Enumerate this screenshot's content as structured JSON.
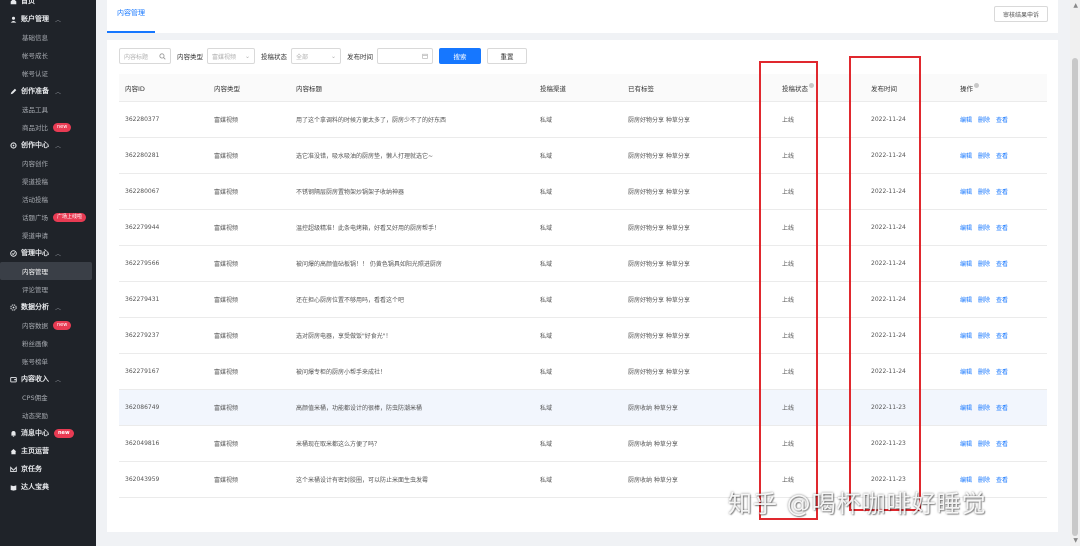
{
  "sidebar": {
    "items": [
      {
        "kind": "group",
        "label": "首页",
        "icon": "home-icon",
        "chev": false
      },
      {
        "kind": "group",
        "label": "账户管理",
        "icon": "user-icon",
        "chev": true
      },
      {
        "kind": "sub",
        "label": "基础信息"
      },
      {
        "kind": "sub",
        "label": "帐号成长"
      },
      {
        "kind": "sub",
        "label": "帐号认证"
      },
      {
        "kind": "group",
        "label": "创作准备",
        "icon": "pen-icon",
        "chev": true
      },
      {
        "kind": "sub",
        "label": "选品工具"
      },
      {
        "kind": "sub",
        "label": "商品对比",
        "badge": "new"
      },
      {
        "kind": "group",
        "label": "创作中心",
        "icon": "gear-icon",
        "chev": true
      },
      {
        "kind": "sub",
        "label": "内容创作"
      },
      {
        "kind": "sub",
        "label": "渠道投稿"
      },
      {
        "kind": "sub",
        "label": "活动投稿"
      },
      {
        "kind": "sub",
        "label": "话题广场",
        "badge": "广场上线啦"
      },
      {
        "kind": "sub",
        "label": "渠道申请"
      },
      {
        "kind": "group",
        "label": "管理中心",
        "icon": "check-circle-icon",
        "chev": true
      },
      {
        "kind": "sub",
        "label": "内容管理",
        "active": true
      },
      {
        "kind": "sub",
        "label": "评论管理"
      },
      {
        "kind": "group",
        "label": "数据分析",
        "icon": "settings-icon",
        "chev": true
      },
      {
        "kind": "sub",
        "label": "内容数据",
        "badge": "new"
      },
      {
        "kind": "sub",
        "label": "粉丝画像"
      },
      {
        "kind": "sub",
        "label": "账号榜单"
      },
      {
        "kind": "group",
        "label": "内容收入",
        "icon": "wallet-icon",
        "chev": true
      },
      {
        "kind": "sub",
        "label": "CPS佣金"
      },
      {
        "kind": "sub",
        "label": "动态奖励"
      },
      {
        "kind": "group",
        "label": "消息中心",
        "icon": "bell-icon",
        "chev": false,
        "badge": "new"
      },
      {
        "kind": "group",
        "label": "主页运营",
        "icon": "house-icon",
        "chev": false
      },
      {
        "kind": "group",
        "label": "京任务",
        "icon": "mail-icon",
        "chev": false
      },
      {
        "kind": "group",
        "label": "达人宝典",
        "icon": "book-icon",
        "chev": false
      }
    ]
  },
  "topbar": {
    "tab": "内容管理",
    "review_button": "审核结果申诉"
  },
  "filters": {
    "keyword_placeholder": "内容标题",
    "type_label": "内容类型",
    "type_value": "富媒视频",
    "status_label": "投稿状态",
    "status_value": "全部",
    "time_label": "发布时间",
    "search_button": "搜索",
    "reset_button": "重置"
  },
  "table": {
    "headers": {
      "id": "内容ID",
      "type": "内容类型",
      "title": "内容标题",
      "channel": "投稿渠道",
      "tags": "已有标签",
      "status": "投稿状态",
      "time": "发布时间",
      "ops": "操作"
    },
    "op_labels": {
      "edit": "编辑",
      "delete": "删除",
      "view": "查看"
    },
    "rows": [
      {
        "id": "362280377",
        "type": "富媒视频",
        "title": "用了这个拿调料的时候方便太多了，厨房少不了的好东西",
        "channel": "私域",
        "tags": "厨房好物分享  种草分享",
        "status": "上线",
        "time": "2022-11-24"
      },
      {
        "id": "362280281",
        "type": "富媒视频",
        "title": "选它准没错，吸水吸油的厨房垫，懒人打理就选它~",
        "channel": "私域",
        "tags": "厨房好物分享  种草分享",
        "status": "上线",
        "time": "2022-11-24"
      },
      {
        "id": "362280067",
        "type": "富媒视频",
        "title": "不锈钢隔层厨房置物架炒锅架子收纳神器",
        "channel": "私域",
        "tags": "厨房好物分享  种草分享",
        "status": "上线",
        "time": "2022-11-24"
      },
      {
        "id": "362279944",
        "type": "富媒视频",
        "title": "温控超级精准！此条电烤箱，好看又好用的厨房帮手！",
        "channel": "私域",
        "tags": "厨房好物分享  种草分享",
        "status": "上线",
        "time": "2022-11-24"
      },
      {
        "id": "362279566",
        "type": "富媒视频",
        "title": "被问爆的高颜值砧板锅！！ 仍黄色锅具如阳光照进厨房",
        "channel": "私域",
        "tags": "厨房好物分享  种草分享",
        "status": "上线",
        "time": "2022-11-24"
      },
      {
        "id": "362279431",
        "type": "富媒视频",
        "title": "还在担心厨房位置不够用吗，看看这个吧",
        "channel": "私域",
        "tags": "厨房好物分享  种草分享",
        "status": "上线",
        "time": "2022-11-24"
      },
      {
        "id": "362279237",
        "type": "富媒视频",
        "title": "选对厨房电器，享受做饭\"好食光\"！",
        "channel": "私域",
        "tags": "厨房好物分享  种草分享",
        "status": "上线",
        "time": "2022-11-24"
      },
      {
        "id": "362279167",
        "type": "富媒视频",
        "title": "被问爆专柜的厨房小帮手来成社！",
        "channel": "私域",
        "tags": "厨房好物分享  种草分享",
        "status": "上线",
        "time": "2022-11-24"
      },
      {
        "id": "362086749",
        "type": "富媒视频",
        "title": "高颜值米桶，功能都设计的很棒，防虫防潮米桶",
        "channel": "私域",
        "tags": "厨房收纳  种草分享",
        "status": "上线",
        "time": "2022-11-23",
        "highlight": true
      },
      {
        "id": "362049816",
        "type": "富媒视频",
        "title": "米桶现在取米都这么方便了吗？",
        "channel": "私域",
        "tags": "厨房收纳  种草分享",
        "status": "上线",
        "time": "2022-11-23"
      },
      {
        "id": "362043959",
        "type": "富媒视频",
        "title": "这个米桶设计有密封胶圈，可以防止米面生虫发霉",
        "channel": "私域",
        "tags": "厨房收纳  种草分享",
        "status": "上线",
        "time": "2022-11-23"
      }
    ]
  },
  "watermark": "知乎 @喝杯咖啡好睡觉",
  "colors": {
    "accent": "#1677ff",
    "sidebar_bg": "#1f2329",
    "highlight_box": "#e0282e",
    "badge": "#e83b53"
  }
}
